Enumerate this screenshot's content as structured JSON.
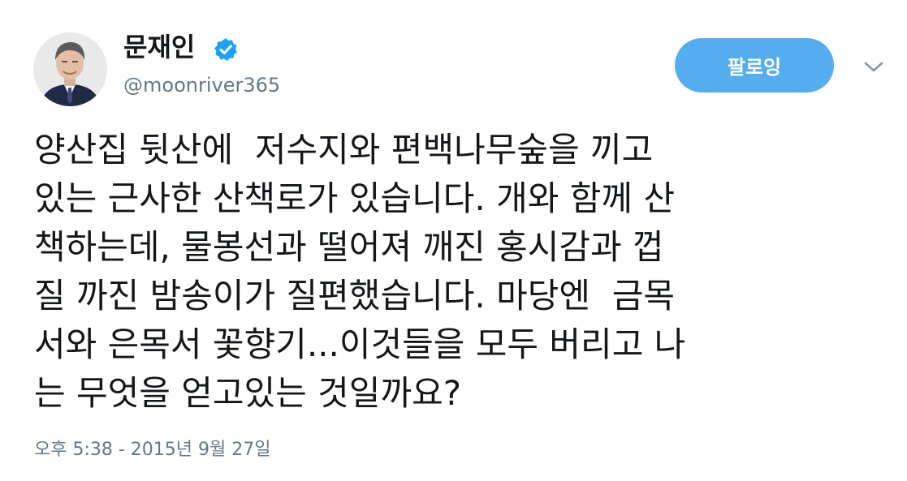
{
  "tweet": {
    "author": {
      "display_name": "문재인",
      "handle": "@moonriver365",
      "verified": true,
      "avatar_icon": "portrait-photo"
    },
    "follow_label": "팔로잉",
    "menu_icon": "chevron-down-icon",
    "text_lines": [
      "양산집 뒷산에  저수지와 편백나무숲을 끼고",
      "있는 근사한 산책로가 있습니다. 개와 함께 산",
      "책하는데, 물봉선과 떨어져 깨진 홍시감과 껍",
      "질 까진 밤송이가 질편했습니다. 마당엔  금목",
      "서와 은목서 꽃향기...이것들을 모두 버리고 나",
      "는 무엇을 얻고있는 것일까요?"
    ],
    "timestamp": "오후 5:38 - 2015년 9월 27일"
  },
  "colors": {
    "follow_button": "#55acee",
    "verified_badge": "#1da1f2",
    "secondary_text": "#657786",
    "primary_text": "#14171a"
  }
}
